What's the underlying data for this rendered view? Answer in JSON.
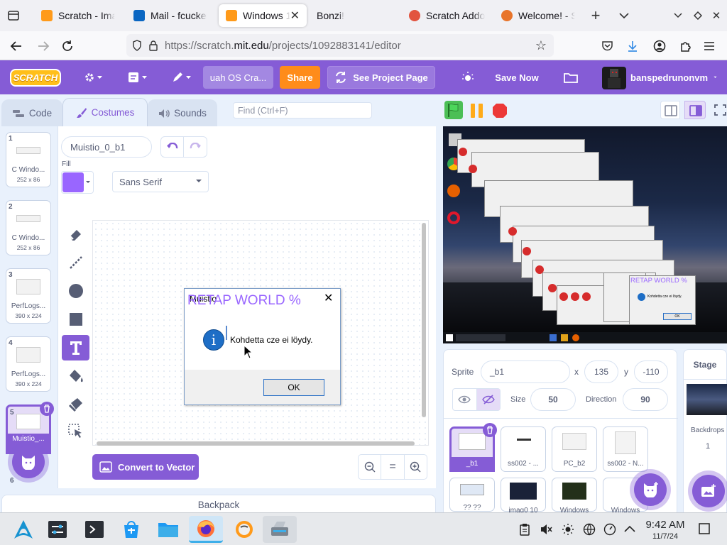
{
  "browser": {
    "tabs": [
      {
        "label": "Scratch - Ima",
        "color": "#ff9a1a"
      },
      {
        "label": "Mail - fcucker",
        "color": "#0a66c2"
      },
      {
        "label": "Windows 1",
        "color": "#ff9a1a",
        "active": true
      },
      {
        "label": "Bonzi!",
        "color": ""
      },
      {
        "label": "Scratch Addo",
        "color": "#e2543f"
      },
      {
        "label": "Welcome! - S",
        "color": "#e8742a"
      }
    ],
    "url_prefix": "https://scratch.",
    "url_domain": "mit.edu",
    "url_path": "/projects/1092883141/editor"
  },
  "menubar": {
    "project_title": "uah OS Cra...",
    "share": "Share",
    "see_project": "See Project Page",
    "save_now": "Save Now",
    "username": "banspedrunonvm",
    "brand_color": "#855cd6"
  },
  "editor_tabs": {
    "code": "Code",
    "costumes": "Costumes",
    "sounds": "Sounds"
  },
  "find_placeholder": "Find (Ctrl+F)",
  "costumes": [
    {
      "num": "1",
      "name": "C Windo...",
      "size": "252 x 86"
    },
    {
      "num": "2",
      "name": "C Windo...",
      "size": "252 x 86"
    },
    {
      "num": "3",
      "name": "PerfLogs...",
      "size": "390 x 224"
    },
    {
      "num": "4",
      "name": "PerfLogs...",
      "size": "390 x 224"
    },
    {
      "num": "5",
      "name": "Muistio_...",
      "size": ""
    },
    {
      "num": "6",
      "name": "",
      "size": ""
    }
  ],
  "paint": {
    "costume_name": "Muistio_0_b1",
    "fill_label": "Fill",
    "fill_color": "#9966ff",
    "font": "Sans Serif",
    "convert_button": "Convert to Vector"
  },
  "dialog": {
    "title": "Muistio",
    "overlay_text": "RETAP WORLD %",
    "message": "Kohdetta cze ei löydy.",
    "ok": "OK"
  },
  "backpack": "Backpack",
  "sprite_info": {
    "sprite_label": "Sprite",
    "sprite_name": "_b1",
    "x_label": "x",
    "x": "135",
    "y_label": "y",
    "y": "-110",
    "size_label": "Size",
    "size": "50",
    "direction_label": "Direction",
    "direction": "90"
  },
  "sprites": [
    {
      "name": "_b1",
      "selected": true
    },
    {
      "name": "ss002 - ..."
    },
    {
      "name": "PC_b2"
    },
    {
      "name": "ss002 - N..."
    },
    {
      "name": "?? ??"
    },
    {
      "name": "imag0 10"
    },
    {
      "name": "Windows"
    },
    {
      "name": "Windows"
    }
  ],
  "stage_panel": {
    "title": "Stage",
    "backdrops_label": "Backdrops",
    "backdrops_count": "1"
  },
  "stage": {
    "overlay_text": "RETAP WORLD %",
    "message": "Kohdetta cze ei löydy.",
    "ok": "OK"
  },
  "taskbar": {
    "time": "9:42 AM",
    "date": "11/7/24"
  }
}
